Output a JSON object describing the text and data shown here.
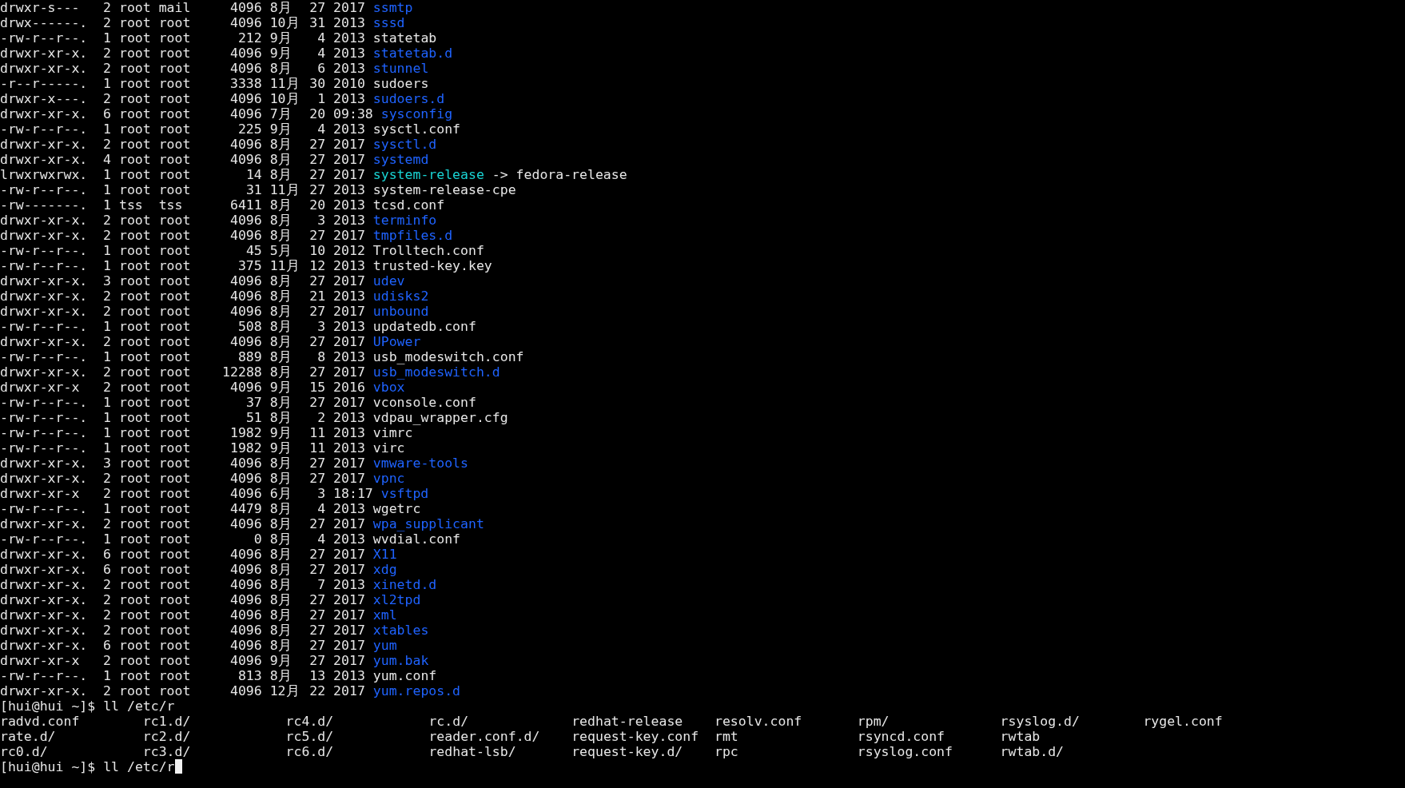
{
  "listing": [
    {
      "perms": "drwxr-s---",
      "links": "2",
      "owner": "root",
      "group": "mail",
      "size": "4096",
      "month": "8月",
      "day": "27",
      "time": "2017",
      "name": "ssmtp",
      "kind": "dir"
    },
    {
      "perms": "drwx------.",
      "links": "2",
      "owner": "root",
      "group": "root",
      "size": "4096",
      "month": "10月",
      "day": "31",
      "time": "2013",
      "name": "sssd",
      "kind": "dir"
    },
    {
      "perms": "-rw-r--r--.",
      "links": "1",
      "owner": "root",
      "group": "root",
      "size": "212",
      "month": "9月",
      "day": "4",
      "time": "2013",
      "name": "statetab",
      "kind": "file"
    },
    {
      "perms": "drwxr-xr-x.",
      "links": "2",
      "owner": "root",
      "group": "root",
      "size": "4096",
      "month": "9月",
      "day": "4",
      "time": "2013",
      "name": "statetab.d",
      "kind": "dir"
    },
    {
      "perms": "drwxr-xr-x.",
      "links": "2",
      "owner": "root",
      "group": "root",
      "size": "4096",
      "month": "8月",
      "day": "6",
      "time": "2013",
      "name": "stunnel",
      "kind": "dir"
    },
    {
      "perms": "-r--r-----.",
      "links": "1",
      "owner": "root",
      "group": "root",
      "size": "3338",
      "month": "11月",
      "day": "30",
      "time": "2010",
      "name": "sudoers",
      "kind": "file"
    },
    {
      "perms": "drwxr-x---.",
      "links": "2",
      "owner": "root",
      "group": "root",
      "size": "4096",
      "month": "10月",
      "day": "1",
      "time": "2013",
      "name": "sudoers.d",
      "kind": "dir"
    },
    {
      "perms": "drwxr-xr-x.",
      "links": "6",
      "owner": "root",
      "group": "root",
      "size": "4096",
      "month": "7月",
      "day": "20",
      "time": "09:38",
      "name": "sysconfig",
      "kind": "dir"
    },
    {
      "perms": "-rw-r--r--.",
      "links": "1",
      "owner": "root",
      "group": "root",
      "size": "225",
      "month": "9月",
      "day": "4",
      "time": "2013",
      "name": "sysctl.conf",
      "kind": "file"
    },
    {
      "perms": "drwxr-xr-x.",
      "links": "2",
      "owner": "root",
      "group": "root",
      "size": "4096",
      "month": "8月",
      "day": "27",
      "time": "2017",
      "name": "sysctl.d",
      "kind": "dir"
    },
    {
      "perms": "drwxr-xr-x.",
      "links": "4",
      "owner": "root",
      "group": "root",
      "size": "4096",
      "month": "8月",
      "day": "27",
      "time": "2017",
      "name": "systemd",
      "kind": "dir"
    },
    {
      "perms": "lrwxrwxrwx.",
      "links": "1",
      "owner": "root",
      "group": "root",
      "size": "14",
      "month": "8月",
      "day": "27",
      "time": "2017",
      "name": "system-release",
      "kind": "link",
      "target": "-> fedora-release"
    },
    {
      "perms": "-rw-r--r--.",
      "links": "1",
      "owner": "root",
      "group": "root",
      "size": "31",
      "month": "11月",
      "day": "27",
      "time": "2013",
      "name": "system-release-cpe",
      "kind": "file"
    },
    {
      "perms": "-rw-------.",
      "links": "1",
      "owner": "tss",
      "group": "tss",
      "size": "6411",
      "month": "8月",
      "day": "20",
      "time": "2013",
      "name": "tcsd.conf",
      "kind": "file"
    },
    {
      "perms": "drwxr-xr-x.",
      "links": "2",
      "owner": "root",
      "group": "root",
      "size": "4096",
      "month": "8月",
      "day": "3",
      "time": "2013",
      "name": "terminfo",
      "kind": "dir"
    },
    {
      "perms": "drwxr-xr-x.",
      "links": "2",
      "owner": "root",
      "group": "root",
      "size": "4096",
      "month": "8月",
      "day": "27",
      "time": "2017",
      "name": "tmpfiles.d",
      "kind": "dir"
    },
    {
      "perms": "-rw-r--r--.",
      "links": "1",
      "owner": "root",
      "group": "root",
      "size": "45",
      "month": "5月",
      "day": "10",
      "time": "2012",
      "name": "Trolltech.conf",
      "kind": "file"
    },
    {
      "perms": "-rw-r--r--.",
      "links": "1",
      "owner": "root",
      "group": "root",
      "size": "375",
      "month": "11月",
      "day": "12",
      "time": "2013",
      "name": "trusted-key.key",
      "kind": "file"
    },
    {
      "perms": "drwxr-xr-x.",
      "links": "3",
      "owner": "root",
      "group": "root",
      "size": "4096",
      "month": "8月",
      "day": "27",
      "time": "2017",
      "name": "udev",
      "kind": "dir"
    },
    {
      "perms": "drwxr-xr-x.",
      "links": "2",
      "owner": "root",
      "group": "root",
      "size": "4096",
      "month": "8月",
      "day": "21",
      "time": "2013",
      "name": "udisks2",
      "kind": "dir"
    },
    {
      "perms": "drwxr-xr-x.",
      "links": "2",
      "owner": "root",
      "group": "root",
      "size": "4096",
      "month": "8月",
      "day": "27",
      "time": "2017",
      "name": "unbound",
      "kind": "dir"
    },
    {
      "perms": "-rw-r--r--.",
      "links": "1",
      "owner": "root",
      "group": "root",
      "size": "508",
      "month": "8月",
      "day": "3",
      "time": "2013",
      "name": "updatedb.conf",
      "kind": "file"
    },
    {
      "perms": "drwxr-xr-x.",
      "links": "2",
      "owner": "root",
      "group": "root",
      "size": "4096",
      "month": "8月",
      "day": "27",
      "time": "2017",
      "name": "UPower",
      "kind": "dir"
    },
    {
      "perms": "-rw-r--r--.",
      "links": "1",
      "owner": "root",
      "group": "root",
      "size": "889",
      "month": "8月",
      "day": "8",
      "time": "2013",
      "name": "usb_modeswitch.conf",
      "kind": "file"
    },
    {
      "perms": "drwxr-xr-x.",
      "links": "2",
      "owner": "root",
      "group": "root",
      "size": "12288",
      "month": "8月",
      "day": "27",
      "time": "2017",
      "name": "usb_modeswitch.d",
      "kind": "dir"
    },
    {
      "perms": "drwxr-xr-x",
      "links": "2",
      "owner": "root",
      "group": "root",
      "size": "4096",
      "month": "9月",
      "day": "15",
      "time": "2016",
      "name": "vbox",
      "kind": "dir"
    },
    {
      "perms": "-rw-r--r--.",
      "links": "1",
      "owner": "root",
      "group": "root",
      "size": "37",
      "month": "8月",
      "day": "27",
      "time": "2017",
      "name": "vconsole.conf",
      "kind": "file"
    },
    {
      "perms": "-rw-r--r--.",
      "links": "1",
      "owner": "root",
      "group": "root",
      "size": "51",
      "month": "8月",
      "day": "2",
      "time": "2013",
      "name": "vdpau_wrapper.cfg",
      "kind": "file"
    },
    {
      "perms": "-rw-r--r--.",
      "links": "1",
      "owner": "root",
      "group": "root",
      "size": "1982",
      "month": "9月",
      "day": "11",
      "time": "2013",
      "name": "vimrc",
      "kind": "file"
    },
    {
      "perms": "-rw-r--r--.",
      "links": "1",
      "owner": "root",
      "group": "root",
      "size": "1982",
      "month": "9月",
      "day": "11",
      "time": "2013",
      "name": "virc",
      "kind": "file"
    },
    {
      "perms": "drwxr-xr-x.",
      "links": "3",
      "owner": "root",
      "group": "root",
      "size": "4096",
      "month": "8月",
      "day": "27",
      "time": "2017",
      "name": "vmware-tools",
      "kind": "dir"
    },
    {
      "perms": "drwxr-xr-x.",
      "links": "2",
      "owner": "root",
      "group": "root",
      "size": "4096",
      "month": "8月",
      "day": "27",
      "time": "2017",
      "name": "vpnc",
      "kind": "dir"
    },
    {
      "perms": "drwxr-xr-x",
      "links": "2",
      "owner": "root",
      "group": "root",
      "size": "4096",
      "month": "6月",
      "day": "3",
      "time": "18:17",
      "name": "vsftpd",
      "kind": "dir"
    },
    {
      "perms": "-rw-r--r--.",
      "links": "1",
      "owner": "root",
      "group": "root",
      "size": "4479",
      "month": "8月",
      "day": "4",
      "time": "2013",
      "name": "wgetrc",
      "kind": "file"
    },
    {
      "perms": "drwxr-xr-x.",
      "links": "2",
      "owner": "root",
      "group": "root",
      "size": "4096",
      "month": "8月",
      "day": "27",
      "time": "2017",
      "name": "wpa_supplicant",
      "kind": "dir"
    },
    {
      "perms": "-rw-r--r--.",
      "links": "1",
      "owner": "root",
      "group": "root",
      "size": "0",
      "month": "8月",
      "day": "4",
      "time": "2013",
      "name": "wvdial.conf",
      "kind": "file"
    },
    {
      "perms": "drwxr-xr-x.",
      "links": "6",
      "owner": "root",
      "group": "root",
      "size": "4096",
      "month": "8月",
      "day": "27",
      "time": "2017",
      "name": "X11",
      "kind": "dir"
    },
    {
      "perms": "drwxr-xr-x.",
      "links": "6",
      "owner": "root",
      "group": "root",
      "size": "4096",
      "month": "8月",
      "day": "27",
      "time": "2017",
      "name": "xdg",
      "kind": "dir"
    },
    {
      "perms": "drwxr-xr-x.",
      "links": "2",
      "owner": "root",
      "group": "root",
      "size": "4096",
      "month": "8月",
      "day": "7",
      "time": "2013",
      "name": "xinetd.d",
      "kind": "dir"
    },
    {
      "perms": "drwxr-xr-x.",
      "links": "2",
      "owner": "root",
      "group": "root",
      "size": "4096",
      "month": "8月",
      "day": "27",
      "time": "2017",
      "name": "xl2tpd",
      "kind": "dir"
    },
    {
      "perms": "drwxr-xr-x.",
      "links": "2",
      "owner": "root",
      "group": "root",
      "size": "4096",
      "month": "8月",
      "day": "27",
      "time": "2017",
      "name": "xml",
      "kind": "dir"
    },
    {
      "perms": "drwxr-xr-x.",
      "links": "2",
      "owner": "root",
      "group": "root",
      "size": "4096",
      "month": "8月",
      "day": "27",
      "time": "2017",
      "name": "xtables",
      "kind": "dir"
    },
    {
      "perms": "drwxr-xr-x.",
      "links": "6",
      "owner": "root",
      "group": "root",
      "size": "4096",
      "month": "8月",
      "day": "27",
      "time": "2017",
      "name": "yum",
      "kind": "dir"
    },
    {
      "perms": "drwxr-xr-x",
      "links": "2",
      "owner": "root",
      "group": "root",
      "size": "4096",
      "month": "9月",
      "day": "27",
      "time": "2017",
      "name": "yum.bak",
      "kind": "dir"
    },
    {
      "perms": "-rw-r--r--.",
      "links": "1",
      "owner": "root",
      "group": "root",
      "size": "813",
      "month": "8月",
      "day": "13",
      "time": "2013",
      "name": "yum.conf",
      "kind": "file"
    },
    {
      "perms": "drwxr-xr-x.",
      "links": "2",
      "owner": "root",
      "group": "root",
      "size": "4096",
      "month": "12月",
      "day": "22",
      "time": "2017",
      "name": "yum.repos.d",
      "kind": "dir"
    }
  ],
  "prompt_1": {
    "text": "[hui@hui ~]$ ll /etc/r",
    "cursor": false
  },
  "completions": [
    [
      "radvd.conf",
      "rc1.d/",
      "rc4.d/",
      "rc.d/",
      "redhat-release",
      "resolv.conf",
      "rpm/",
      "rsyslog.d/",
      "rygel.conf"
    ],
    [
      "rate.d/",
      "rc2.d/",
      "rc5.d/",
      "reader.conf.d/",
      "request-key.conf",
      "rmt",
      "rsyncd.conf",
      "rwtab"
    ],
    [
      "rc0.d/",
      "rc3.d/",
      "rc6.d/",
      "redhat-lsb/",
      "request-key.d/",
      "rpc",
      "rsyslog.conf",
      "rwtab.d/"
    ]
  ],
  "prompt_2": {
    "text": "[hui@hui ~]$ ll /etc/r",
    "cursor": true
  }
}
